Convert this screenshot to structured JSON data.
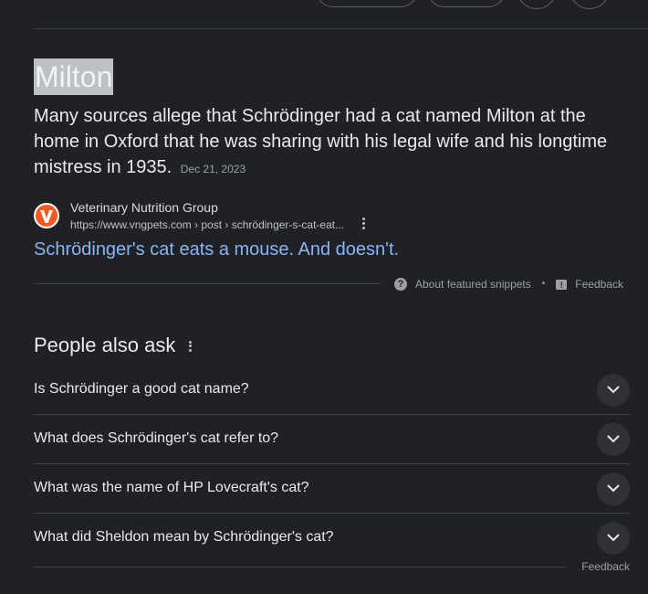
{
  "featured_snippet": {
    "answer": "Milton",
    "text": "Many sources allege that Schrödinger had a cat named Milton at the home in Oxford that he was sharing with his legal wife and his longtime mistress in 1935.",
    "date": "Dec 21, 2023",
    "source": {
      "name": "Veterinary Nutrition Group",
      "url": "https://www.vngpets.com › post › schrödinger-s-cat-eat...",
      "logo_letter": "V",
      "logo_color": "#f15a22"
    },
    "link_title": "Schrödinger's cat eats a mouse. And doesn't.",
    "about_label": "About featured snippets",
    "separator": "•",
    "feedback_label": "Feedback"
  },
  "people_also_ask": {
    "title": "People also ask",
    "questions": [
      "Is Schrödinger a good cat name?",
      "What does Schrödinger's cat refer to?",
      "What was the name of HP Lovecraft's cat?",
      "What did Sheldon mean by Schrödinger's cat?"
    ],
    "feedback_label": "Feedback"
  },
  "colors": {
    "background": "#202124",
    "link": "#8ab4f8",
    "text": "#e8eaed",
    "muted": "#9aa0a6",
    "answer_highlight": "#bdc1c6"
  }
}
